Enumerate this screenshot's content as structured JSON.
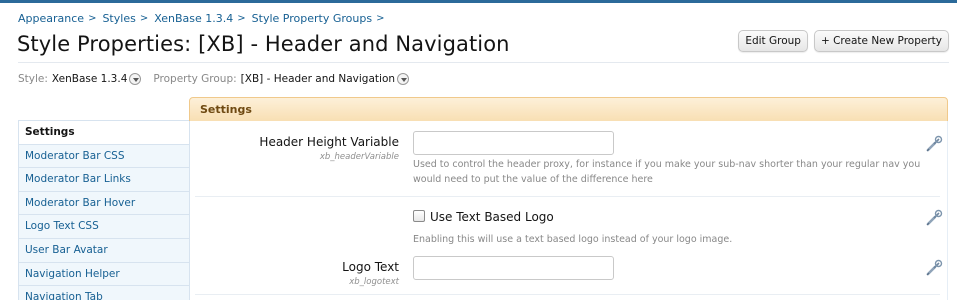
{
  "breadcrumb": [
    {
      "label": "Appearance"
    },
    {
      "label": "Styles"
    },
    {
      "label": "XenBase 1.3.4"
    },
    {
      "label": "Style Property Groups"
    }
  ],
  "breadcrumb_separator": ">",
  "page": {
    "title": "Style Properties: [XB] - Header and Navigation"
  },
  "buttons": {
    "edit_group": "Edit Group",
    "create_property": "+ Create New Property"
  },
  "filter": {
    "style_label": "Style:",
    "style_value": "XenBase 1.3.4",
    "group_label": "Property Group:",
    "group_value": "[XB] - Header and Navigation"
  },
  "sidebar": {
    "items": [
      {
        "label": "Settings"
      },
      {
        "label": "Moderator Bar CSS"
      },
      {
        "label": "Moderator Bar Links"
      },
      {
        "label": "Moderator Bar Hover"
      },
      {
        "label": "Logo Text CSS"
      },
      {
        "label": "User Bar Avatar"
      },
      {
        "label": "Navigation Helper"
      },
      {
        "label": "Navigation Tab"
      }
    ]
  },
  "settings": {
    "header": "Settings",
    "rows": [
      {
        "label": "Header Height Variable",
        "varname": "xb_headerVariable",
        "value": "",
        "explain": "Used to control the header proxy, for instance if you make your sub-nav shorter than your regular nav you would need to put the value of the difference here"
      },
      {
        "checkbox_label": "Use Text Based Logo",
        "checked": false,
        "explain": "Enabling this will use a text based logo instead of your logo image."
      },
      {
        "label": "Logo Text",
        "varname": "xb_logotext",
        "value": ""
      }
    ]
  },
  "icons": {
    "edit": "wrench-pencil-icon"
  },
  "colors": {
    "link": "#176093",
    "header_bg": "#f8dfb3",
    "header_text": "#6f4a12",
    "sidebar_bg": "#f0f7fc"
  }
}
